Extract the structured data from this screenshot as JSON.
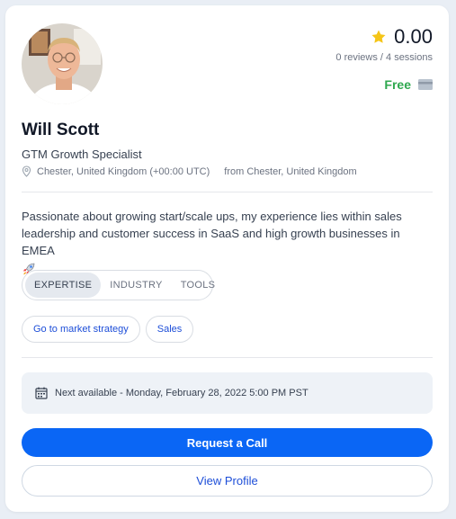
{
  "profile": {
    "name": "Will Scott",
    "title": "GTM Growth Specialist",
    "location": "Chester, United Kingdom (+00:00 UTC)",
    "from": "from Chester, United Kingdom",
    "bio": "Passionate about growing start/scale ups, my experience lies within sales leadership and customer success in SaaS and high growth businesses in EMEA",
    "avatar_icon": "person-photo"
  },
  "rating": {
    "value": "0.00",
    "stats": "0 reviews / 4 sessions",
    "star_color": "#f5c518"
  },
  "price": {
    "label": "Free",
    "color": "#2fa84f"
  },
  "tabs": [
    "EXPERTISE",
    "INDUSTRY",
    "TOOLS"
  ],
  "active_tab": "EXPERTISE",
  "chips": [
    "Go to market strategy",
    "Sales"
  ],
  "availability": "Next available - Monday, February 28, 2022 5:00 PM PST",
  "buttons": {
    "primary": "Request a Call",
    "secondary": "View Profile"
  },
  "colors": {
    "accent": "#0a66f5",
    "link": "#1d4ed8"
  }
}
